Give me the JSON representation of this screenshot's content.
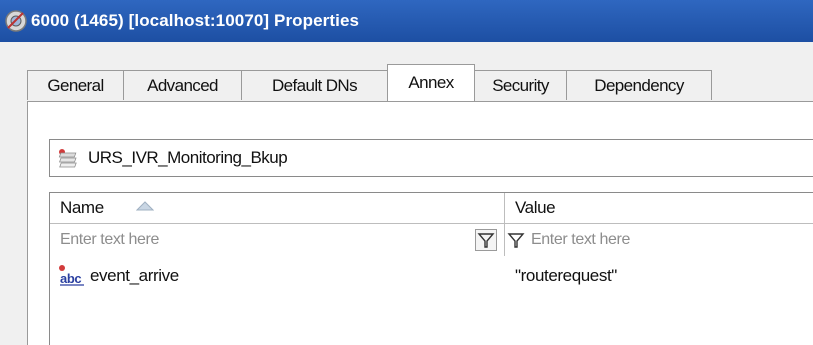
{
  "window": {
    "title": "6000 (1465) [localhost:10070] Properties"
  },
  "tabs": [
    {
      "label": "General"
    },
    {
      "label": "Advanced"
    },
    {
      "label": "Default DNs"
    },
    {
      "label": "Annex"
    },
    {
      "label": "Security"
    },
    {
      "label": "Dependency"
    }
  ],
  "active_tab": "Annex",
  "section_selector": {
    "value": "URS_IVR_Monitoring_Bkup",
    "icon": "section-icon"
  },
  "grid": {
    "columns": [
      {
        "label": "Name",
        "sorted": "ascending"
      },
      {
        "label": "Value"
      }
    ],
    "filter_placeholders": [
      "Enter text here",
      "Enter text here"
    ],
    "rows": [
      {
        "name": "event_arrive",
        "value": "\"routerequest\"",
        "icon": "abc-string-icon"
      }
    ]
  },
  "colors": {
    "titlebar": "#1d4fa3",
    "background": "#f0f0f0"
  }
}
